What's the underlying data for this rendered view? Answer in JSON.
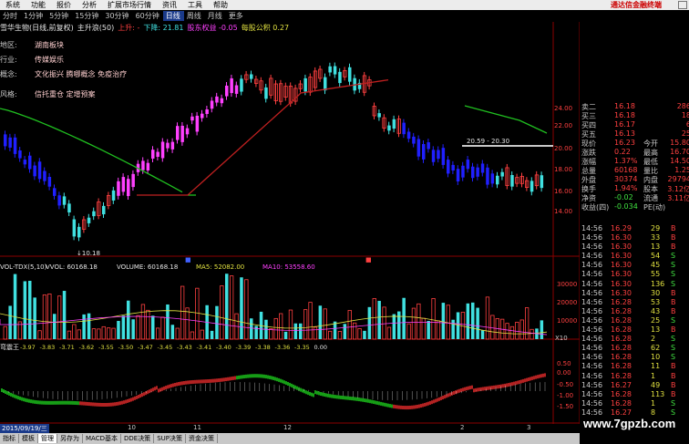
{
  "menu": {
    "items": [
      "系统",
      "功能",
      "报价",
      "分析",
      "扩展市场行情",
      "资讯",
      "工具",
      "帮助"
    ],
    "logo": "通达信金融终端"
  },
  "periods": [
    "分时",
    "1分钟",
    "5分钟",
    "15分钟",
    "30分钟",
    "60分钟",
    "日线",
    "周线",
    "月线",
    "更多"
  ],
  "active_period": "日线",
  "main_title": {
    "name": "雪华生物(日线,前复权)",
    "indicator": "主升浪(50)",
    "up": "上升: -",
    "down": "下降: 21.81",
    "profit": "股东权益 -0.05",
    "ratio": "每股公积 0.27"
  },
  "info_rows": [
    {
      "label": "地区:",
      "value": "湖南板块"
    },
    {
      "label": "行业:",
      "value": "传媒娱乐"
    },
    {
      "label": "概念:",
      "value": "文化振兴 腾哪概念 免疫治疗"
    },
    {
      "label": "风格:",
      "value": "信托重仓 定增预案"
    }
  ],
  "price_axis": [
    "24.00",
    "22.00",
    "20.00",
    "18.00",
    "16.00",
    "14.00"
  ],
  "price_labels": {
    "high": "↓10.18",
    "line": "20.59 - 20.30"
  },
  "volume_title": {
    "name": "VOL-TDX(5,10)",
    "vvol": "VVOL: 60168.18",
    "volume": "VOLUME: 60168.18",
    "ma5": "MA5: 52082.00",
    "ma10": "MA10: 53558.60"
  },
  "volume_axis": [
    "30000",
    "20000",
    "10000"
  ],
  "volume_unit": "X10",
  "osc_title": {
    "name": "弯震王",
    "values": [
      "-3.97",
      "-3.83",
      "-3.71",
      "-3.62",
      "-3.55",
      "-3.50",
      "-3.47",
      "-3.45",
      "-3.43",
      "-3.41",
      "-3.40",
      "-3.39",
      "-3.38",
      "-3.36",
      "-3.35",
      "0.00"
    ]
  },
  "osc_axis": [
    "0.50",
    "0.00",
    "-0.50",
    "-1.00",
    "-1.50"
  ],
  "dates": {
    "current": "2015/09/19/三",
    "ticks": [
      "10",
      "11",
      "12",
      "2",
      "3"
    ]
  },
  "quote": [
    {
      "l": "卖二",
      "p": "16.18",
      "v": "286"
    },
    {
      "l": "买三",
      "p": "16.18",
      "v": "18"
    },
    {
      "l": "买四",
      "p": "16.17",
      "v": "6"
    },
    {
      "l": "买五",
      "p": "16.13",
      "v": "25"
    },
    {
      "l": "现价",
      "p": "16.23",
      "l2": "今开",
      "v": "15.80"
    },
    {
      "l": "涨跌",
      "p": "0.22",
      "l2": "最高",
      "v": "16.70"
    },
    {
      "l": "涨幅",
      "p": "1.37%",
      "l2": "最低",
      "v": "14.50"
    },
    {
      "l": "总量",
      "p": "60168",
      "l2": "量比",
      "v": "1.25"
    },
    {
      "l": "外盘",
      "p": "30374",
      "l2": "内盘",
      "v": "29794"
    },
    {
      "l": "换手",
      "p": "1.94%",
      "l2": "股本",
      "v": "3.12亿"
    },
    {
      "l": "净资",
      "p": "-0.02",
      "l2": "流通",
      "v": "3.11亿"
    },
    {
      "l": "收益(四)",
      "p": "-0.034",
      "l2": "PE(动)",
      "v": ""
    }
  ],
  "trades": [
    {
      "t": "14:56",
      "p": "16.29",
      "v": "29",
      "d": "B"
    },
    {
      "t": "14:56",
      "p": "16.30",
      "v": "33",
      "d": "B"
    },
    {
      "t": "14:56",
      "p": "16.30",
      "v": "13",
      "d": "B"
    },
    {
      "t": "14:56",
      "p": "16.30",
      "v": "54",
      "d": "S"
    },
    {
      "t": "14:56",
      "p": "16.30",
      "v": "45",
      "d": "S"
    },
    {
      "t": "14:56",
      "p": "16.30",
      "v": "55",
      "d": "S"
    },
    {
      "t": "14:56",
      "p": "16.30",
      "v": "136",
      "d": "S"
    },
    {
      "t": "14:56",
      "p": "16.30",
      "v": "30",
      "d": "B"
    },
    {
      "t": "14:56",
      "p": "16.28",
      "v": "53",
      "d": "B"
    },
    {
      "t": "14:56",
      "p": "16.28",
      "v": "43",
      "d": "B"
    },
    {
      "t": "14:56",
      "p": "16.28",
      "v": "25",
      "d": "S"
    },
    {
      "t": "14:56",
      "p": "16.28",
      "v": "13",
      "d": "B"
    },
    {
      "t": "14:56",
      "p": "16.28",
      "v": "2",
      "d": "S"
    },
    {
      "t": "14:56",
      "p": "16.28",
      "v": "62",
      "d": "S"
    },
    {
      "t": "14:56",
      "p": "16.28",
      "v": "10",
      "d": "S"
    },
    {
      "t": "14:56",
      "p": "16.28",
      "v": "11",
      "d": "B"
    },
    {
      "t": "14:56",
      "p": "16.28",
      "v": "1",
      "d": "B"
    },
    {
      "t": "14:56",
      "p": "16.27",
      "v": "49",
      "d": "B"
    },
    {
      "t": "14:56",
      "p": "16.28",
      "v": "113",
      "d": "B"
    },
    {
      "t": "14:56",
      "p": "16.28",
      "v": "1",
      "d": "S"
    },
    {
      "t": "14:56",
      "p": "16.27",
      "v": "8",
      "d": "S"
    }
  ],
  "tabs": [
    "指标",
    "模板",
    "管理",
    "另存为",
    "MACD基本",
    "DDE决策",
    "SUP决策",
    "资金决策"
  ],
  "watermark": "www.7gpzb.com",
  "colors": {
    "up": "#ff4040",
    "down": "#40e0e0",
    "pink": "#ff40ff",
    "blue": "#2020ff",
    "ma_green": "#20c020",
    "ma_red": "#c02020"
  }
}
